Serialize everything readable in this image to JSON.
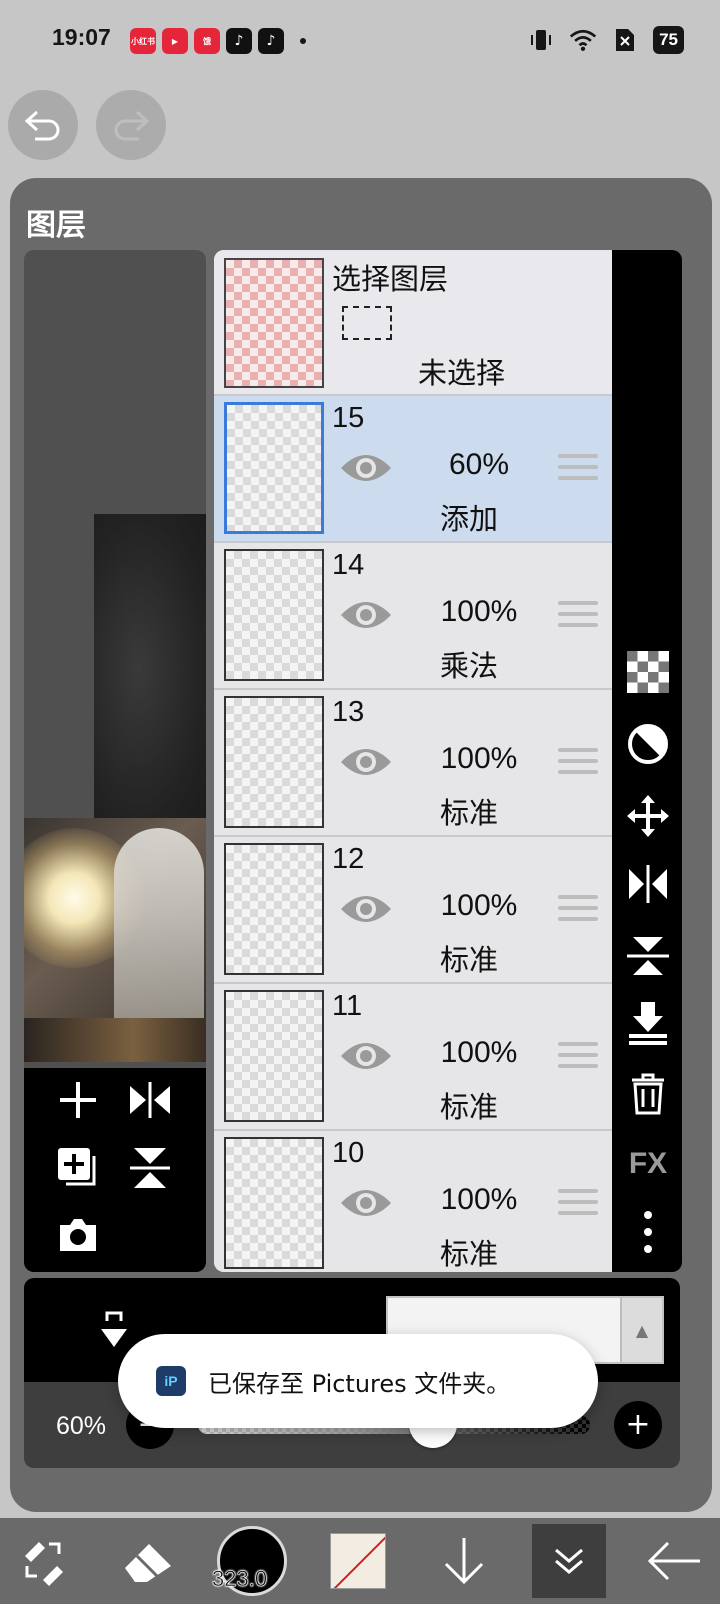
{
  "status_bar": {
    "time": "19:07",
    "app_icons": [
      "小红书",
      "视频",
      "饿了么",
      "TikTok",
      "TikTok"
    ],
    "battery": "75"
  },
  "panel": {
    "title": "图层"
  },
  "selection_layer": {
    "title": "选择图层",
    "status": "未选择"
  },
  "layers": [
    {
      "number": "15",
      "opacity": "60%",
      "blend": "添加",
      "active": true
    },
    {
      "number": "14",
      "opacity": "100%",
      "blend": "乘法",
      "active": false
    },
    {
      "number": "13",
      "opacity": "100%",
      "blend": "标准",
      "active": false
    },
    {
      "number": "12",
      "opacity": "100%",
      "blend": "标准",
      "active": false
    },
    {
      "number": "11",
      "opacity": "100%",
      "blend": "标准",
      "active": false
    },
    {
      "number": "10",
      "opacity": "100%",
      "blend": "标准",
      "active": false
    }
  ],
  "right_tools": {
    "fx_label": "FX"
  },
  "opacity_control": {
    "label": "60%",
    "minus": "−",
    "plus": "+",
    "value": 0.6
  },
  "toast": {
    "icon_text": "iP",
    "message": "已保存至 Pictures 文件夹。"
  },
  "bottom_toolbar": {
    "brush_size": "323.0"
  },
  "colors": {
    "active_layer_bg": "#cddbee",
    "active_layer_border": "#3a7ad8",
    "panel_bg": "#6a6a6a"
  }
}
